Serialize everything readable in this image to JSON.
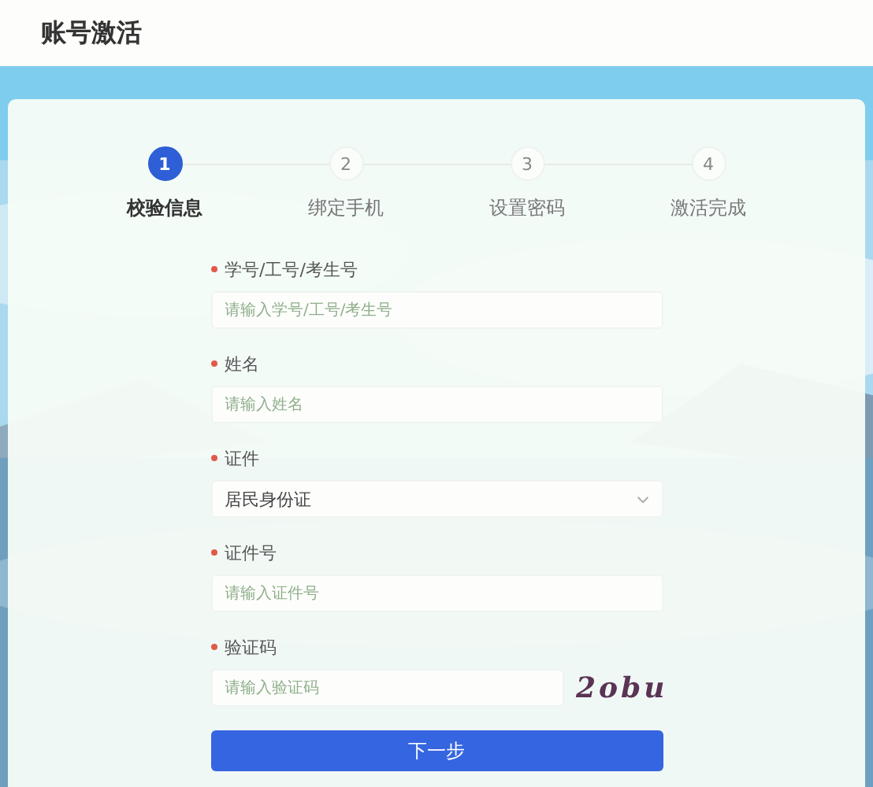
{
  "header": {
    "title": "账号激活"
  },
  "steps": [
    {
      "number": "1",
      "label": "校验信息",
      "selected": true
    },
    {
      "number": "2",
      "label": "绑定手机",
      "selected": false
    },
    {
      "number": "3",
      "label": "设置密码",
      "selected": false
    },
    {
      "number": "4",
      "label": "激活完成",
      "selected": false
    }
  ],
  "fields": [
    {
      "kind": "text",
      "label": "学号/工号/考生号",
      "required": true,
      "placeholder": "请输入学号/工号/考生号"
    },
    {
      "kind": "text",
      "label": "姓名",
      "required": true,
      "placeholder": "请输入姓名"
    },
    {
      "kind": "select",
      "label": "证件",
      "required": true,
      "value": "居民身份证"
    },
    {
      "kind": "text",
      "label": "证件号",
      "required": true,
      "placeholder": "请输入证件号"
    },
    {
      "kind": "captcha",
      "label": "验证码",
      "required": true,
      "placeholder": "请输入验证码",
      "captcha": "2obu"
    }
  ],
  "submit": "下一步"
}
